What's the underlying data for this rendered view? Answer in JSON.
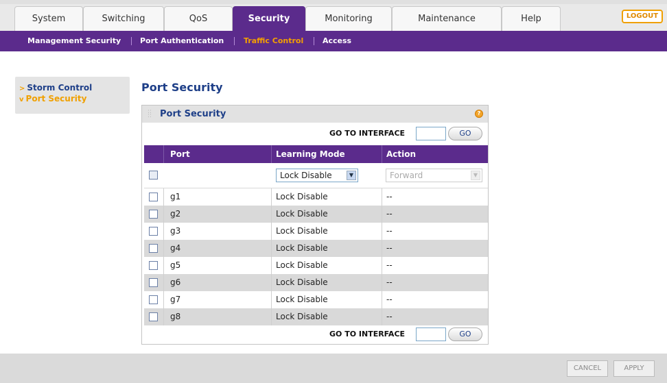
{
  "tabs": [
    {
      "label": "System"
    },
    {
      "label": "Switching"
    },
    {
      "label": "QoS"
    },
    {
      "label": "Security",
      "active": true
    },
    {
      "label": "Monitoring"
    },
    {
      "label": "Maintenance"
    },
    {
      "label": "Help"
    }
  ],
  "logout_label": "LOGOUT",
  "subnav": [
    {
      "label": "Management Security"
    },
    {
      "label": "Port Authentication"
    },
    {
      "label": "Traffic Control",
      "active": true
    },
    {
      "label": "Access"
    }
  ],
  "leftnav": [
    {
      "label": "Storm Control"
    },
    {
      "label": "Port Security",
      "active": true
    }
  ],
  "page_title": "Port Security",
  "panel": {
    "title": "Port Security",
    "help_icon": "?",
    "goto_label": "GO TO INTERFACE",
    "goto_value": "",
    "go_label": "GO",
    "columns": [
      "Port",
      "Learning Mode",
      "Action"
    ],
    "filter": {
      "learning_mode": "Lock Disable",
      "action": "Forward"
    },
    "rows": [
      {
        "port": "g1",
        "mode": "Lock Disable",
        "action": "--"
      },
      {
        "port": "g2",
        "mode": "Lock Disable",
        "action": "--"
      },
      {
        "port": "g3",
        "mode": "Lock Disable",
        "action": "--"
      },
      {
        "port": "g4",
        "mode": "Lock Disable",
        "action": "--"
      },
      {
        "port": "g5",
        "mode": "Lock Disable",
        "action": "--"
      },
      {
        "port": "g6",
        "mode": "Lock Disable",
        "action": "--"
      },
      {
        "port": "g7",
        "mode": "Lock Disable",
        "action": "--"
      },
      {
        "port": "g8",
        "mode": "Lock Disable",
        "action": "--"
      }
    ]
  },
  "footer": {
    "cancel": "CANCEL",
    "apply": "APPLY"
  },
  "colors": {
    "primary": "#5b2b8c",
    "accent": "#f0a000",
    "link": "#1e3f88"
  }
}
